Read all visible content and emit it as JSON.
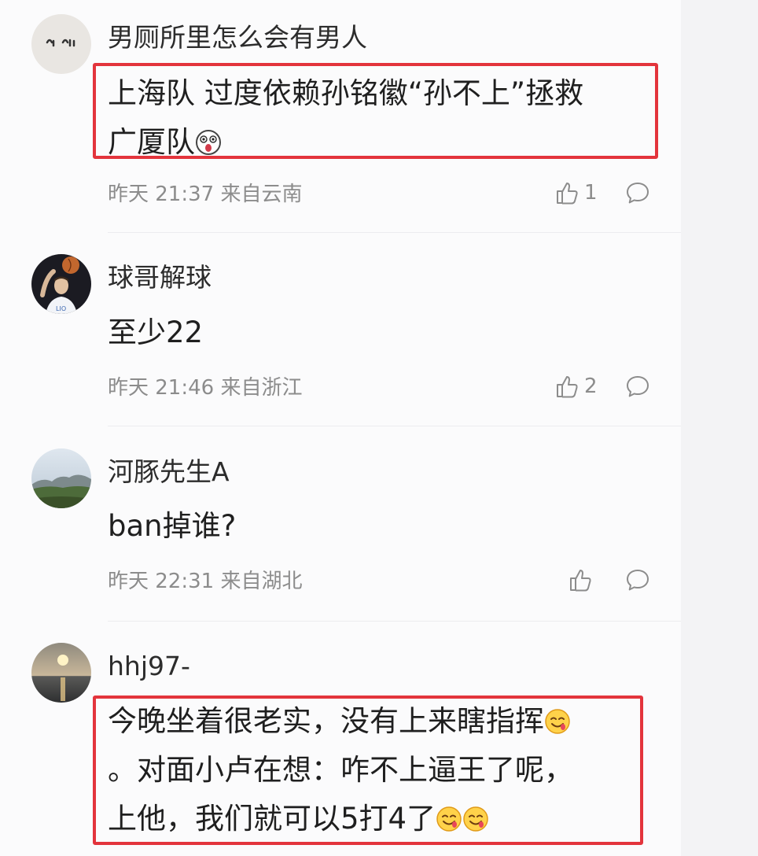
{
  "comments": [
    {
      "username": "男厕所里怎么会有男人",
      "lines": [
        "上海队 过度依赖孙铭徽“孙不上”拯救",
        "广厦队"
      ],
      "meta": "昨天 21:37 来自云南",
      "likes": "1",
      "avatar_icon": "doodle-face-avatar",
      "highlighted": true
    },
    {
      "username": "球哥解球",
      "lines": [
        "至少22"
      ],
      "meta": "昨天 21:46 来自浙江",
      "likes": "2",
      "avatar_icon": "basketball-player-avatar",
      "highlighted": false
    },
    {
      "username": "河豚先生A",
      "lines": [
        "ban掉谁?"
      ],
      "meta": "昨天 22:31 来自湖北",
      "likes": "",
      "avatar_icon": "landscape-avatar",
      "highlighted": false
    },
    {
      "username": "hhj97-",
      "lines": [
        "今晚坐着很老实，没有上来瞎指挥",
        "。对面小卢在想：咋不上逼王了呢，",
        "上他，我们就可以5打4了"
      ],
      "meta": "",
      "likes": "",
      "avatar_icon": "sunset-sea-avatar",
      "highlighted": true
    }
  ],
  "colors": {
    "highlight_border": "#e3343c",
    "meta_text": "#8c8c8c",
    "background": "#fbfbfc"
  },
  "icons": {
    "like": "thumbs-up-icon",
    "reply": "speech-bubble-icon",
    "emoji_shocked": "shocked-face-emoji",
    "emoji_drool": "drooling-face-emoji"
  }
}
